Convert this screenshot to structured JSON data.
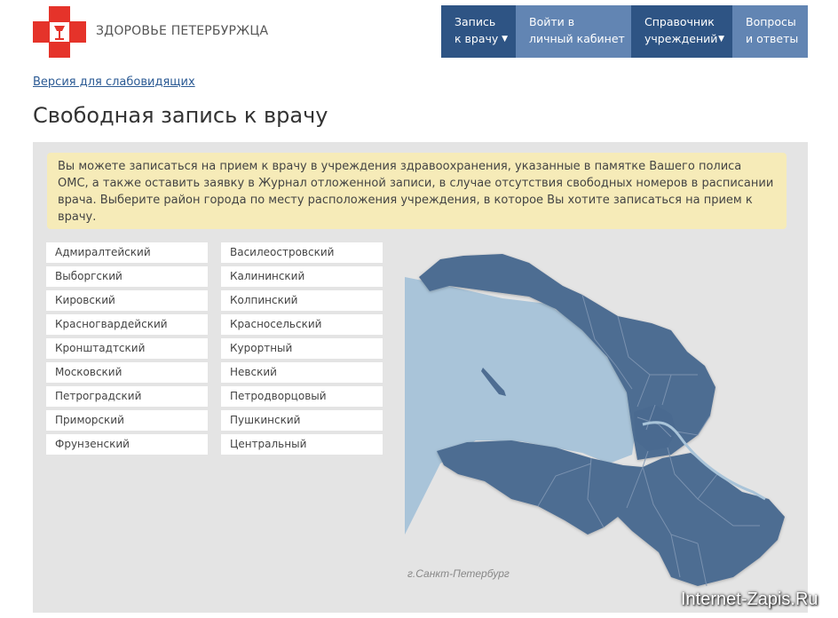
{
  "brand": {
    "name": "ЗДОРОВЬЕ ПЕТЕРБУРЖЦА",
    "color": "#e5332a"
  },
  "nav": [
    {
      "line1": "Запись",
      "line2": "к врачу",
      "caret": "▼"
    },
    {
      "line1": "Войти в",
      "line2": "личный кабинет",
      "caret": ""
    },
    {
      "line1": "Справочник",
      "line2": "учреждений",
      "caret": "▼"
    },
    {
      "line1": "Вопросы",
      "line2": "и ответы",
      "caret": ""
    }
  ],
  "vision_link": "Версия для слабовидящих",
  "title": "Свободная запись к врачу",
  "notice": "Вы можете записаться на прием к врачу в учреждения здравоохранения, указанные в памятке Вашего полиса ОМС, а также оставить заявку в Журнал отложенной записи, в случае отсутствия свободных номеров в расписании врача. Выберите район города по месту расположения учреждения, в которое Вы хотите записаться на прием к врачу.",
  "districts_left": [
    "Адмиралтейский",
    "Выборгский",
    "Кировский",
    "Красногвардейский",
    "Кронштадтский",
    "Московский",
    "Петроградский",
    "Приморский",
    "Фрунзенский"
  ],
  "districts_right": [
    "Василеостровский",
    "Калининский",
    "Колпинский",
    "Красносельский",
    "Курортный",
    "Невский",
    "Петродворцовый",
    "Пушкинский",
    "Центральный"
  ],
  "map_caption": "г.Санкт-Петербург",
  "watermark": "Internet-Zapis.Ru",
  "colors": {
    "nav_dark": "#2e5484",
    "nav_light": "#6285b3",
    "map_land": "#4e6d92",
    "map_water": "#a9c4d9"
  }
}
